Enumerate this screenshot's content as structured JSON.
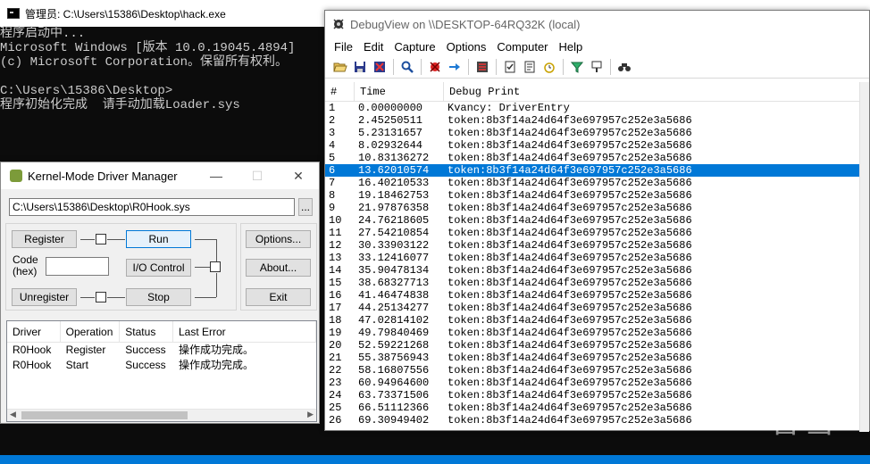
{
  "console": {
    "title": "管理员: C:\\Users\\15386\\Desktop\\hack.exe",
    "lines": [
      "程序启动中...",
      "Microsoft Windows [版本 10.0.19045.4894]",
      "(c) Microsoft Corporation。保留所有权利。",
      "",
      "C:\\Users\\15386\\Desktop>",
      "程序初始化完成  请手动加载Loader.sys"
    ],
    "controls": {
      "minimize": "—",
      "close": "□"
    }
  },
  "debugview": {
    "title": "DebugView on \\\\DESKTOP-64RQ32K (local)",
    "menu": [
      "File",
      "Edit",
      "Capture",
      "Options",
      "Computer",
      "Help"
    ],
    "toolbar_icons": [
      "open-icon",
      "save-icon",
      "clear-icon",
      "find-icon",
      "capture-icon",
      "autoscroll-icon",
      "clear-display-icon",
      "capture-kernel-icon",
      "pass-through-icon",
      "clock-icon",
      "filter-icon",
      "highlight-icon",
      "history-icon"
    ],
    "columns": [
      "#",
      "Time",
      "Debug Print"
    ],
    "rows": [
      {
        "n": "1",
        "time": "0.00000000",
        "msg": "Kvancy: DriverEntry"
      },
      {
        "n": "2",
        "time": "2.45250511",
        "msg": "token:8b3f14a24d64f3e697957c252e3a5686"
      },
      {
        "n": "3",
        "time": "5.23131657",
        "msg": "token:8b3f14a24d64f3e697957c252e3a5686"
      },
      {
        "n": "4",
        "time": "8.02932644",
        "msg": "token:8b3f14a24d64f3e697957c252e3a5686"
      },
      {
        "n": "5",
        "time": "10.83136272",
        "msg": "token:8b3f14a24d64f3e697957c252e3a5686"
      },
      {
        "n": "6",
        "time": "13.62010574",
        "msg": "token:8b3f14a24d64f3e697957c252e3a5686"
      },
      {
        "n": "7",
        "time": "16.40210533",
        "msg": "token:8b3f14a24d64f3e697957c252e3a5686"
      },
      {
        "n": "8",
        "time": "19.18462753",
        "msg": "token:8b3f14a24d64f3e697957c252e3a5686"
      },
      {
        "n": "9",
        "time": "21.97876358",
        "msg": "token:8b3f14a24d64f3e697957c252e3a5686"
      },
      {
        "n": "10",
        "time": "24.76218605",
        "msg": "token:8b3f14a24d64f3e697957c252e3a5686"
      },
      {
        "n": "11",
        "time": "27.54210854",
        "msg": "token:8b3f14a24d64f3e697957c252e3a5686"
      },
      {
        "n": "12",
        "time": "30.33903122",
        "msg": "token:8b3f14a24d64f3e697957c252e3a5686"
      },
      {
        "n": "13",
        "time": "33.12416077",
        "msg": "token:8b3f14a24d64f3e697957c252e3a5686"
      },
      {
        "n": "14",
        "time": "35.90478134",
        "msg": "token:8b3f14a24d64f3e697957c252e3a5686"
      },
      {
        "n": "15",
        "time": "38.68327713",
        "msg": "token:8b3f14a24d64f3e697957c252e3a5686"
      },
      {
        "n": "16",
        "time": "41.46474838",
        "msg": "token:8b3f14a24d64f3e697957c252e3a5686"
      },
      {
        "n": "17",
        "time": "44.25134277",
        "msg": "token:8b3f14a24d64f3e697957c252e3a5686"
      },
      {
        "n": "18",
        "time": "47.02814102",
        "msg": "token:8b3f14a24d64f3e697957c252e3a5686"
      },
      {
        "n": "19",
        "time": "49.79840469",
        "msg": "token:8b3f14a24d64f3e697957c252e3a5686"
      },
      {
        "n": "20",
        "time": "52.59221268",
        "msg": "token:8b3f14a24d64f3e697957c252e3a5686"
      },
      {
        "n": "21",
        "time": "55.38756943",
        "msg": "token:8b3f14a24d64f3e697957c252e3a5686"
      },
      {
        "n": "22",
        "time": "58.16807556",
        "msg": "token:8b3f14a24d64f3e697957c252e3a5686"
      },
      {
        "n": "23",
        "time": "60.94964600",
        "msg": "token:8b3f14a24d64f3e697957c252e3a5686"
      },
      {
        "n": "24",
        "time": "63.73371506",
        "msg": "token:8b3f14a24d64f3e697957c252e3a5686"
      },
      {
        "n": "25",
        "time": "66.51112366",
        "msg": "token:8b3f14a24d64f3e697957c252e3a5686"
      },
      {
        "n": "26",
        "time": "69.30949402",
        "msg": "token:8b3f14a24d64f3e697957c252e3a5686"
      }
    ],
    "selected_row": "6"
  },
  "kmdm": {
    "title": "Kernel-Mode Driver Manager",
    "path_value": "C:\\Users\\15386\\Desktop\\R0Hook.sys",
    "browse_label": "...",
    "register_label": "Register",
    "run_label": "Run",
    "options_label": "Options...",
    "code_label": "Code\n(hex)",
    "io_control_label": "I/O Control",
    "about_label": "About...",
    "unregister_label": "Unregister",
    "stop_label": "Stop",
    "exit_label": "Exit",
    "controls": {
      "minimize": "—",
      "maximize": "☐",
      "close": "✕"
    },
    "list_columns": [
      "Driver",
      "Operation",
      "Status",
      "Last Error"
    ],
    "list_rows": [
      {
        "driver": "R0Hook",
        "operation": "Register",
        "status": "Success",
        "error": "操作成功完成。"
      },
      {
        "driver": "R0Hook",
        "operation": "Start",
        "status": "Success",
        "error": "操作成功完成。"
      }
    ]
  },
  "watermark": {
    "text": "看雪"
  },
  "colors": {
    "selection": "#0078d7",
    "console_bg": "#0c0c0c",
    "console_fg": "#cccccc"
  }
}
